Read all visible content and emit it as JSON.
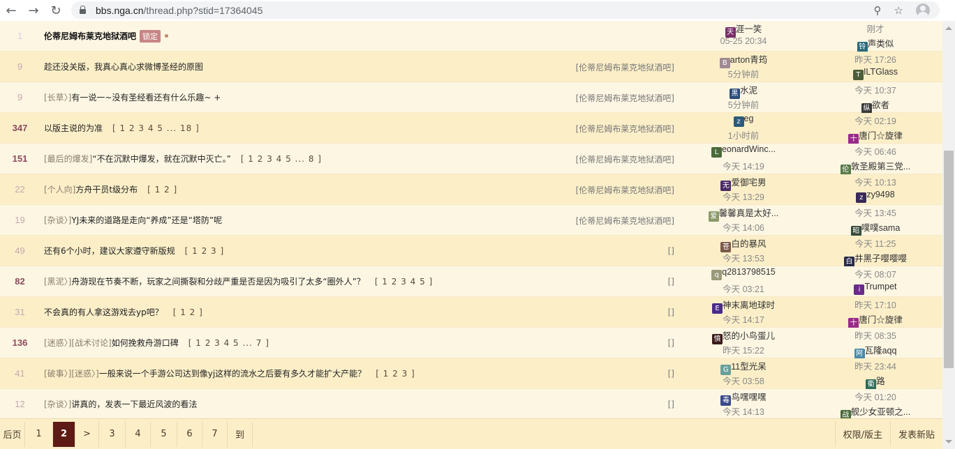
{
  "browser": {
    "url_host": "bbs.nga.cn",
    "url_rest": "/thread.php?stid=17364045"
  },
  "threads": [
    {
      "replies": "1",
      "num_style": "faint",
      "prefix": "",
      "title": "伦蒂尼姆布莱克地狱酒吧",
      "title_bold": true,
      "badge": "锁定",
      "pages": "",
      "forum": "",
      "author_av": "天",
      "author_color": "#7b2d6b",
      "author": "涯一笑",
      "post_time": "05-25 20:34",
      "last_time": "刚才",
      "last_av": "铃",
      "last_color": "#2a6a7a",
      "last_user": "声类似"
    },
    {
      "replies": "9",
      "num_style": "low",
      "prefix": "",
      "title": "趁还没关版，我真心真心求微博圣经的原图",
      "pages": "",
      "forum": "[伦蒂尼姆布莱克地狱酒吧]",
      "author_av": "B",
      "author_color": "#a08a92",
      "author": "arton青筠",
      "post_time": "5分钟前",
      "last_time": "昨天 17:26",
      "last_av": "T",
      "last_color": "#4d5c3a",
      "last_user": "ILTGlass"
    },
    {
      "replies": "9",
      "num_style": "low",
      "prefix": "[长草〉]",
      "title": "有一说一~没有圣经看还有什么乐趣~ +",
      "pages": "",
      "forum": "[伦蒂尼姆布莱克地狱酒吧]",
      "author_av": "黑",
      "author_color": "#2a4c7a",
      "author": "水泥",
      "post_time": "5分钟前",
      "last_time": "今天 10:37",
      "last_av": "纵",
      "last_color": "#3a3a3a",
      "last_user": "欲者"
    },
    {
      "replies": "347",
      "num_style": "",
      "prefix": "",
      "title": "以版主说的为准",
      "pages": "[ 1 2 3 4 5 ... 18 ]",
      "forum": "[伦蒂尼姆布莱克地狱酒吧]",
      "author_av": "z",
      "author_color": "#2d5a7a",
      "author": "eg",
      "post_time": "1小时前",
      "last_time": "今天 02:19",
      "last_av": "十",
      "last_color": "#9a2a8a",
      "last_user": "唐门☆旋律"
    },
    {
      "replies": "151",
      "num_style": "",
      "prefix": "[最后的爆发]",
      "title": "“不在沉默中爆发，就在沉默中灭亡。”",
      "pages": "[ 1 2 3 4 5 ... 8 ]",
      "forum": "[伦蒂尼姆布莱克地狱酒吧]",
      "author_av": "L",
      "author_color": "#4a6a3a",
      "author": "eonardWinc...",
      "post_time": "今天 14:19",
      "last_time": "今天 06:46",
      "last_av": "伦",
      "last_color": "#5a7a4a",
      "last_user": "敦圣殿第三党..."
    },
    {
      "replies": "22",
      "num_style": "low",
      "prefix": "[个人向]",
      "title": "方舟干员t级分布",
      "pages": "[ 1 2 ]",
      "forum": "[伦蒂尼姆布莱克地狱酒吧]",
      "author_av": "无",
      "author_color": "#4a2a6a",
      "author": "爱御宅男",
      "post_time": "今天 13:29",
      "last_time": "今天 10:13",
      "last_av": "z",
      "last_color": "#3a2a5a",
      "last_user": "zy9498"
    },
    {
      "replies": "19",
      "num_style": "low",
      "prefix": "[杂谈〉]",
      "title": "YJ未来的道路是走向“养成”还是“塔防”呢",
      "pages": "",
      "forum": "[伦蒂尼姆布莱克地狱酒吧]",
      "author_av": "爱",
      "author_color": "#8a9a6a",
      "author": "馨馨真是太好...",
      "post_time": "今天 14:06",
      "last_time": "今天 13:45",
      "last_av": "昭",
      "last_color": "#3a4a3a",
      "last_user": "噗噗sama"
    },
    {
      "replies": "49",
      "num_style": "low",
      "prefix": "",
      "title": "还有6个小时，建议大家遵守新版规",
      "pages": "[ 1 2 3 ]",
      "forum": "[]",
      "author_av": "苍",
      "author_color": "#7a5a4a",
      "author": "白的暴风",
      "post_time": "今天 13:53",
      "last_time": "今天 11:25",
      "last_av": "白",
      "last_color": "#2a2a4a",
      "last_user": "井黑子嘤嘤嘤"
    },
    {
      "replies": "82",
      "num_style": "",
      "prefix": "[黑泥〉]",
      "title": "舟游现在节奏不断，玩家之间撕裂和分歧严重是否是因为吸引了太多“圈外人”？",
      "pages": "[ 1 2 3 4 5 ]",
      "forum": "[]",
      "author_av": "q",
      "author_color": "#9a9a7a",
      "author": "q2813798515",
      "post_time": "今天 03:21",
      "last_time": "今天 08:07",
      "last_av": "i",
      "last_color": "#6a2a8a",
      "last_user": "Trumpet"
    },
    {
      "replies": "31",
      "num_style": "low",
      "prefix": "",
      "title": "不会真的有人拿这游戏去yp吧？",
      "pages": "[ 1 2 ]",
      "forum": "[]",
      "author_av": "E",
      "author_color": "#4a2a8a",
      "author": "神末离地球时",
      "post_time": "今天 14:17",
      "last_time": "昨天 17:10",
      "last_av": "十",
      "last_color": "#9a2a8a",
      "last_user": "唐门☆旋律"
    },
    {
      "replies": "136",
      "num_style": "",
      "prefix": "[迷惑〉][战术讨论]",
      "title": "如何挽救舟游口碑",
      "pages": "[ 1 2 3 4 5 ... 7 ]",
      "forum": "[]",
      "author_av": "憤",
      "author_color": "#3a1a1a",
      "author": "怒的小鸟蛋儿",
      "post_time": "昨天 15:22",
      "last_time": "昨天 08:35",
      "last_av": "阿",
      "last_color": "#4a8aaa",
      "last_user": "瓦隆aqq"
    },
    {
      "replies": "41",
      "num_style": "low",
      "prefix": "[破事〉][迷惑〉]",
      "title": "一般来说一个手游公司达到像yj这样的流水之后要有多久才能扩大产能？",
      "pages": "[ 1 2 3 ]",
      "forum": "[]",
      "author_av": "G",
      "author_color": "#6aa09a",
      "author": "11型光呆",
      "post_time": "今天 03:58",
      "last_time": "昨天 23:44",
      "last_av": "衢",
      "last_color": "#2a6a5a",
      "last_user": "路"
    },
    {
      "replies": "12",
      "num_style": "low",
      "prefix": "[杂谈〉]",
      "title": "讲真的，发表一下最近风波的看法",
      "pages": "",
      "forum": "[]",
      "author_av": "毒",
      "author_color": "#3a4a8a",
      "author": "鸟嘿嘿嘿",
      "post_time": "今天 14:13",
      "last_time": "今天 01:20",
      "last_av": "战",
      "last_color": "#4a6a3a",
      "last_user": "舰少女亚顿之..."
    }
  ],
  "pagination": {
    "items": [
      "后页",
      "1",
      "2",
      ">",
      "3",
      "4",
      "5",
      "6",
      "7",
      "到"
    ],
    "current": "2",
    "right": [
      "权限/版主",
      "发表新贴"
    ]
  }
}
